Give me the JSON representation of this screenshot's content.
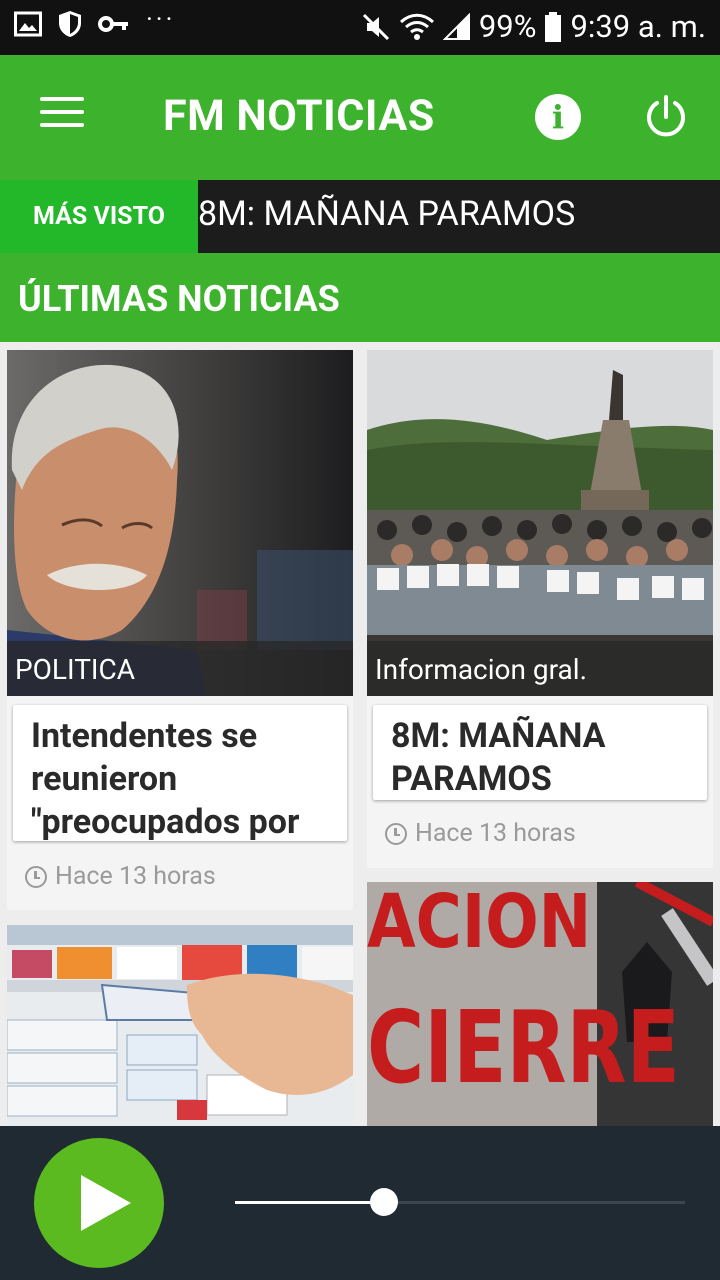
{
  "status_bar": {
    "battery": "99%",
    "time": "9:39 a. m."
  },
  "app_bar": {
    "title": "FM NOTICIAS"
  },
  "ticker": {
    "label": "MÁS VISTO",
    "text": "8M: MAÑANA PARAMOS"
  },
  "section": {
    "title": "ÚLTIMAS NOTICIAS"
  },
  "cards": [
    {
      "category": "POLITICA",
      "headline": "Intendentes se reunieron \"preocupados por",
      "time": "Hace 13 horas"
    },
    {
      "category": "Informacion gral.",
      "headline": "8M: MAÑANA PARAMOS",
      "time": "Hace 13 horas"
    }
  ],
  "player": {
    "progress": 0.33
  },
  "colors": {
    "accent_green": "#3db22c",
    "ticker_green": "#22b829",
    "player_bg": "#1f2a33",
    "play_green": "#5aba1f"
  }
}
